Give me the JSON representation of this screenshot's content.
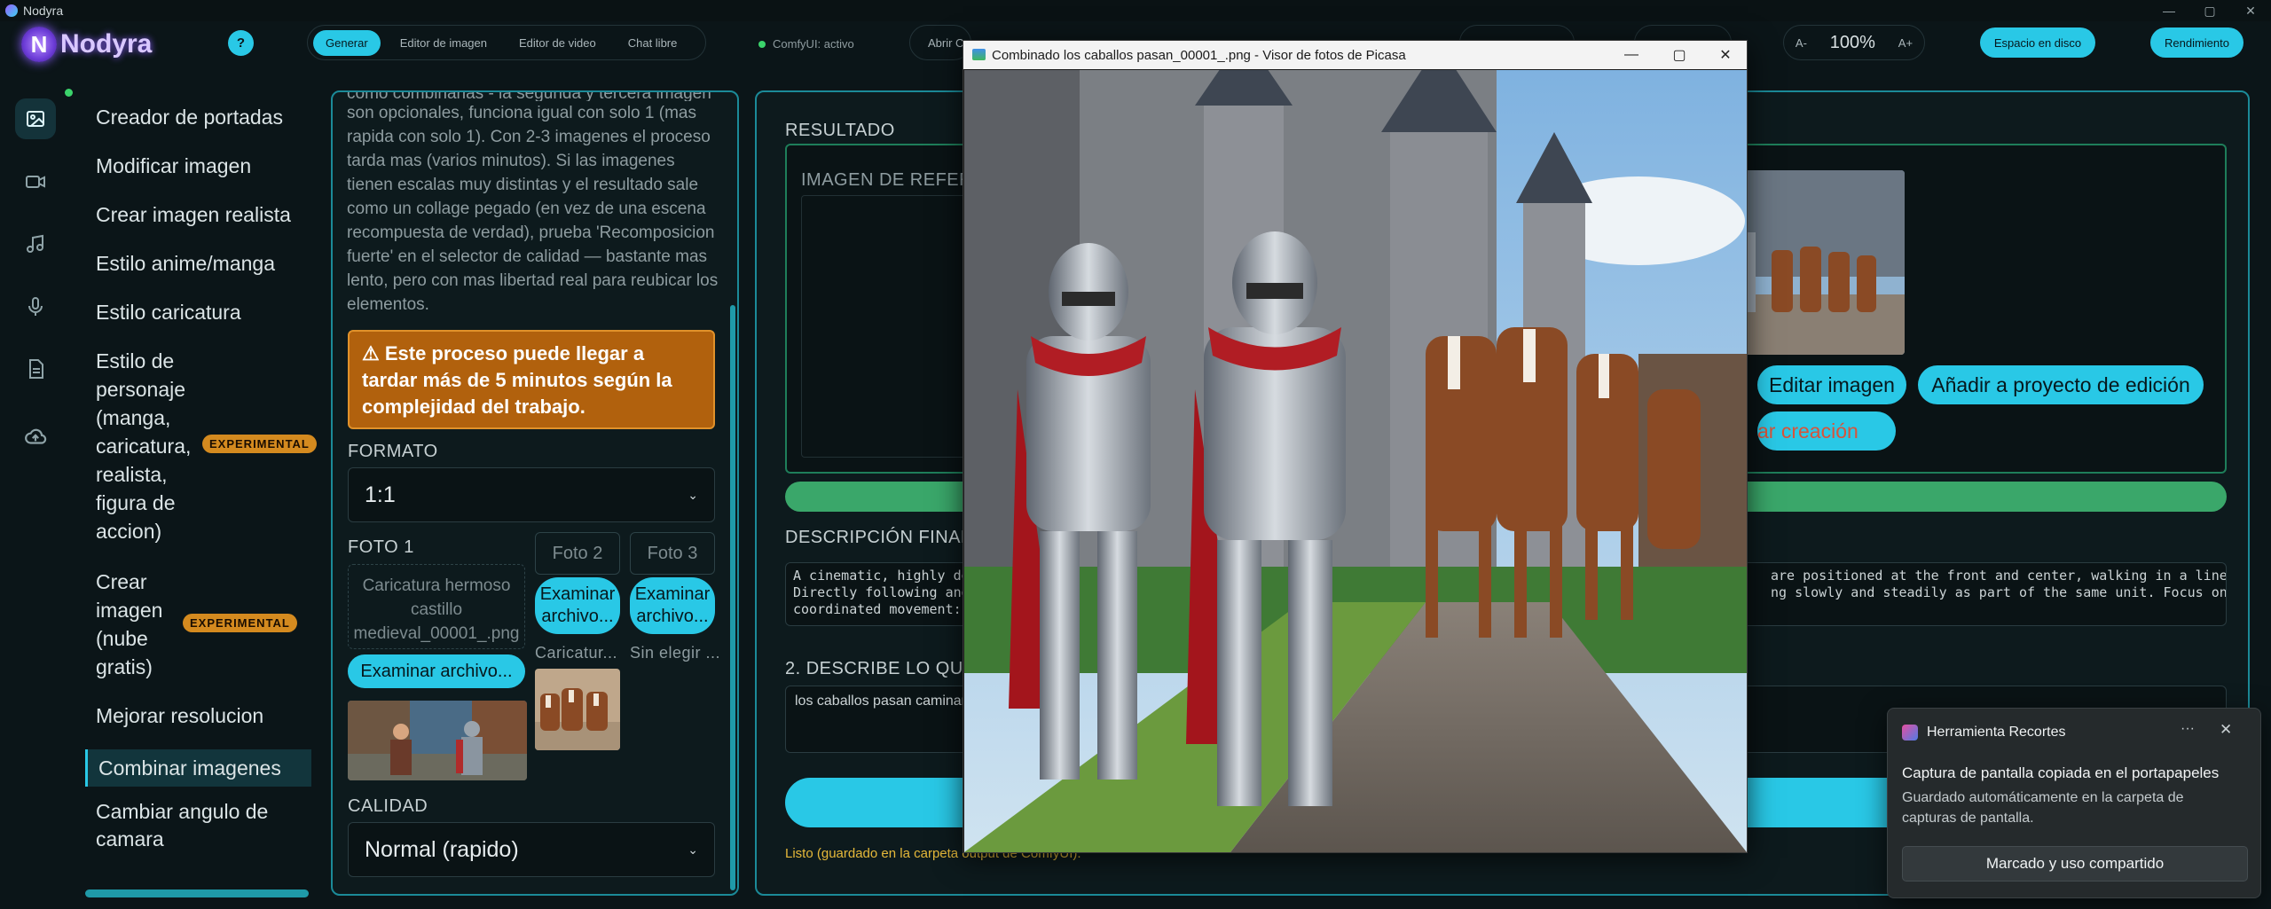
{
  "window": {
    "title": "Nodyra",
    "min": "—",
    "max": "▢",
    "close": "✕"
  },
  "topbar": {
    "logo_mark": "N",
    "logo_text": "Nodyra",
    "help": "?",
    "tabs": [
      "Generar",
      "Editor de imagen",
      "Editor de video",
      "Chat libre"
    ],
    "status": "ComfyUI: activo",
    "open_btn": "Abrir C",
    "zoom_minus": "A-",
    "zoom_value": "100%",
    "zoom_plus": "A+",
    "disk_btn": "Espacio en disco",
    "perf_btn": "Rendimiento"
  },
  "rail": [
    "image-icon",
    "video-icon",
    "music-icon",
    "mic-icon",
    "document-icon",
    "cloud-upload-icon"
  ],
  "menu": {
    "items": [
      {
        "label": "Creador de portadas"
      },
      {
        "label": "Modificar imagen"
      },
      {
        "label": "Crear imagen realista"
      },
      {
        "label": "Estilo anime/manga"
      },
      {
        "label": "Estilo caricatura"
      },
      {
        "label": "Estilo de personaje (manga, caricatura, realista, figura de accion)"
      },
      {
        "label": "Crear imagen (nube gratis)"
      },
      {
        "label": "Mejorar resolucion"
      },
      {
        "label": "Combinar imagenes"
      },
      {
        "label": "Cambiar angulo de camara"
      }
    ],
    "badge": "EXPERIMENTAL",
    "personaje_lines": [
      "Estilo de",
      "personaje",
      "(manga,",
      "caricatura,",
      "realista,",
      "figura de",
      "accion)"
    ],
    "nube_lines": [
      "Crear",
      "imagen",
      "(nube",
      "gratis)"
    ]
  },
  "middle": {
    "help_text_top": "como combinarlas - la segunda y tercera imagen",
    "help_text": "son opcionales, funciona igual con solo 1 (mas rapida con solo 1). Con 2-3 imagenes el proceso tarda mas (varios minutos). Si las imagenes tienen escalas muy distintas y el resultado sale como un collage pegado (en vez de una escena recompuesta de verdad), prueba 'Recomposicion fuerte' en el selector de calidad — bastante mas lento, pero con mas libertad real para reubicar los elementos.",
    "warning": "⚠ Este proceso puede llegar a tardar más de 5 minutos según la complejidad del trabajo.",
    "format_label": "FORMATO",
    "format_value": "1:1",
    "photo1_label": "FOTO 1",
    "photo1_file": "Caricatura hermoso castillo medieval_00001_.png",
    "photo2_label": "Foto 2",
    "photo3_label": "Foto 3",
    "browse": "Examinar archivo...",
    "browse_short": "Examinar archivo...",
    "photo2_name": "Caricatur...",
    "photo3_name": "Sin elegir ...",
    "quality_label": "CALIDAD",
    "quality_value": "Normal (rapido)"
  },
  "right": {
    "result_label": "RESULTADO",
    "ref_label": "IMAGEN DE REFERE",
    "edit_btn": "Editar imagen",
    "add_btn": "Añadir a proyecto de edición",
    "creation_btn": "ar creación",
    "final_label": "DESCRIPCIÓN FINAL",
    "final_text_left": "A cinematic, highly de\nDirectly following and\ncoordinated movement:",
    "final_text_right": "are positioned at the front and center, walking in a line.\nng slowly and steadily as part of the same unit. Focus on the",
    "describe_label": "2. DESCRIBE LO QUE",
    "describe_value": "los caballos pasan caminando",
    "saved": "Listo (guardado en la carpeta output de ComfyUI)."
  },
  "picasa": {
    "title": "Combinado los caballos pasan_00001_.png - Visor de fotos de Picasa",
    "min": "—",
    "max": "▢",
    "close": "✕"
  },
  "toast": {
    "title": "Herramienta Recortes",
    "more": "···",
    "close": "✕",
    "heading": "Captura de pantalla copiada en el portapapeles",
    "body": "Guardado automáticamente en la carpeta de capturas de pantalla.",
    "button": "Marcado y uso compartido"
  },
  "colors": {
    "accent": "#29c8e6",
    "warning": "#b1610d",
    "success": "#3aa76a",
    "brand": "#8a5cff"
  }
}
